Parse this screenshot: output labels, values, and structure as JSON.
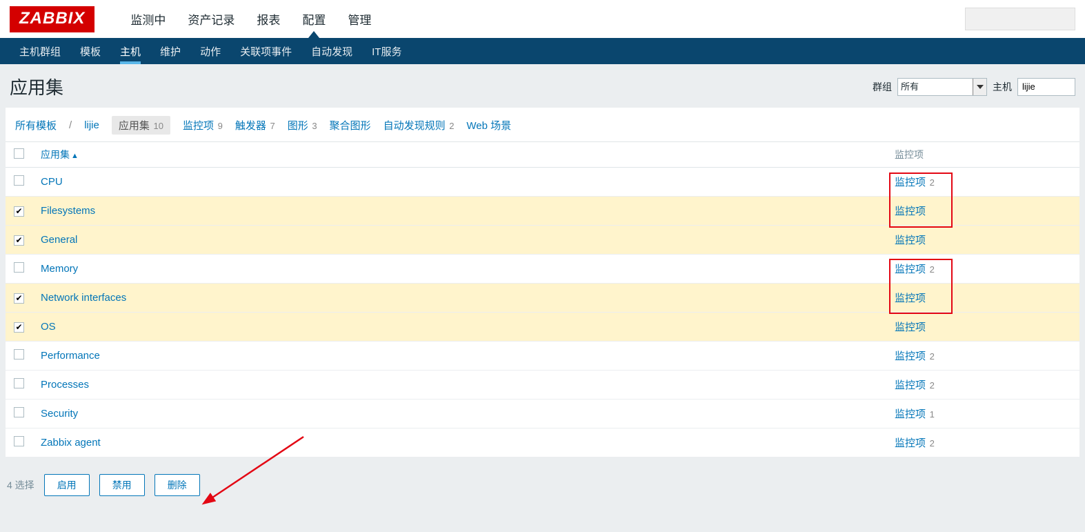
{
  "logo": "ZABBIX",
  "topnav": [
    "监测中",
    "资产记录",
    "报表",
    "配置",
    "管理"
  ],
  "topnav_active": 3,
  "subnav": [
    "主机群组",
    "模板",
    "主机",
    "维护",
    "动作",
    "关联项事件",
    "自动发现",
    "IT服务"
  ],
  "subnav_active": 2,
  "page_title": "应用集",
  "filter": {
    "group_label": "群组",
    "group_value": "所有",
    "host_label": "主机",
    "host_value": "lijie"
  },
  "breadcrumbs": [
    {
      "label": "所有模板"
    },
    {
      "label": "lijie"
    }
  ],
  "tabs": [
    {
      "label": "应用集",
      "count": "10",
      "active": true
    },
    {
      "label": "监控项",
      "count": "9"
    },
    {
      "label": "触发器",
      "count": "7"
    },
    {
      "label": "图形",
      "count": "3"
    },
    {
      "label": "聚合图形",
      "count": ""
    },
    {
      "label": "自动发现规则",
      "count": "2"
    },
    {
      "label": "Web 场景",
      "count": ""
    }
  ],
  "columns": {
    "name": "应用集",
    "items": "监控项"
  },
  "rows": [
    {
      "name": "CPU",
      "items_label": "监控项",
      "items_count": "2",
      "checked": false,
      "highlighted": false
    },
    {
      "name": "Filesystems",
      "items_label": "监控项",
      "items_count": "",
      "checked": true,
      "highlighted": true
    },
    {
      "name": "General",
      "items_label": "监控项",
      "items_count": "",
      "checked": true,
      "highlighted": true
    },
    {
      "name": "Memory",
      "items_label": "监控项",
      "items_count": "2",
      "checked": false,
      "highlighted": false
    },
    {
      "name": "Network interfaces",
      "items_label": "监控项",
      "items_count": "",
      "checked": true,
      "highlighted": true
    },
    {
      "name": "OS",
      "items_label": "监控项",
      "items_count": "",
      "checked": true,
      "highlighted": true
    },
    {
      "name": "Performance",
      "items_label": "监控项",
      "items_count": "2",
      "checked": false,
      "highlighted": false
    },
    {
      "name": "Processes",
      "items_label": "监控项",
      "items_count": "2",
      "checked": false,
      "highlighted": false
    },
    {
      "name": "Security",
      "items_label": "监控项",
      "items_count": "1",
      "checked": false,
      "highlighted": false
    },
    {
      "name": "Zabbix agent",
      "items_label": "监控项",
      "items_count": "2",
      "checked": false,
      "highlighted": false
    }
  ],
  "footer": {
    "selected_text": "4 选择",
    "enable": "启用",
    "disable": "禁用",
    "delete": "删除"
  }
}
